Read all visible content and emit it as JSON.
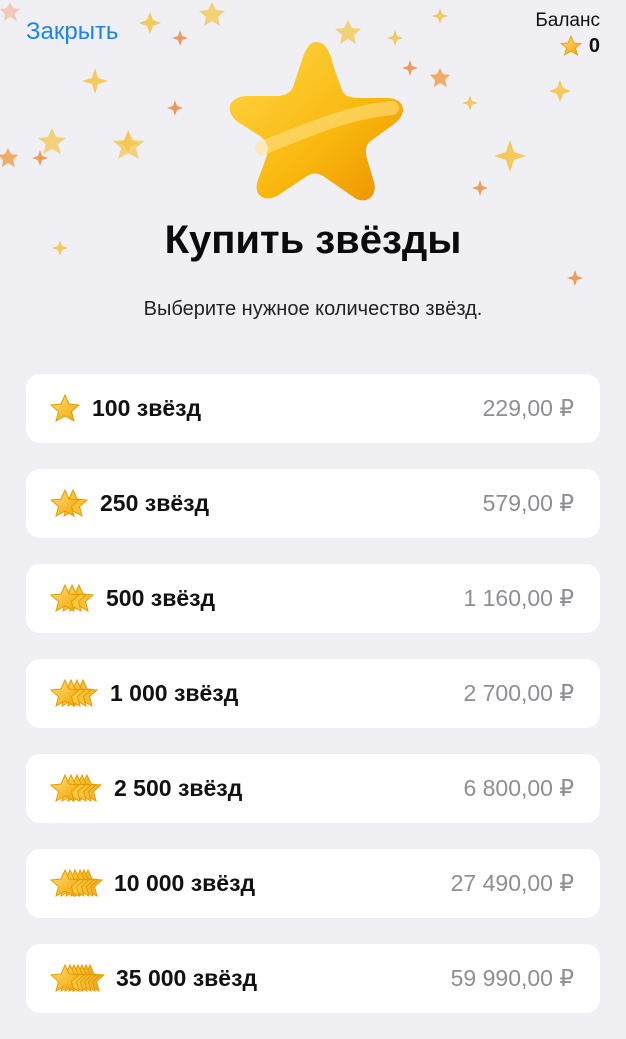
{
  "header": {
    "close_label": "Закрыть",
    "balance_label": "Баланс",
    "balance_value": "0",
    "title": "Купить звёзды",
    "subtitle": "Выберите нужное количество звёзд."
  },
  "colors": {
    "accent": "#1a84f5",
    "star": "#f7b500",
    "background": "#efeff4",
    "price": "#8e8e93"
  },
  "options": [
    {
      "label": "100 звёзд",
      "price": "229,00 ₽",
      "icon": "star-stack-1-icon"
    },
    {
      "label": "250 звёзд",
      "price": "579,00 ₽",
      "icon": "star-stack-2-icon"
    },
    {
      "label": "500 звёзд",
      "price": "1 160,00 ₽",
      "icon": "star-stack-3-icon"
    },
    {
      "label": "1 000 звёзд",
      "price": "2 700,00 ₽",
      "icon": "star-stack-4-icon"
    },
    {
      "label": "2 500 звёзд",
      "price": "6 800,00 ₽",
      "icon": "star-stack-5-icon"
    },
    {
      "label": "10 000 звёзд",
      "price": "27 490,00 ₽",
      "icon": "star-stack-6-icon"
    },
    {
      "label": "35 000 звёзд",
      "price": "59 990,00 ₽",
      "icon": "star-stack-7-icon"
    }
  ]
}
